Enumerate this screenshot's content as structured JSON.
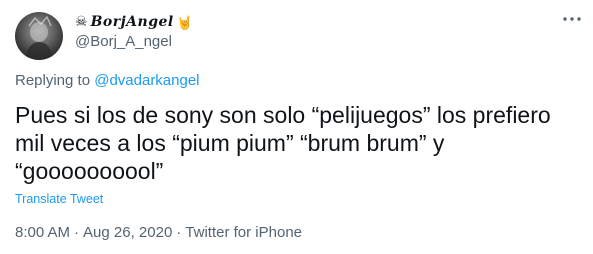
{
  "author": {
    "display_name": "BorjAngel",
    "name_prefix": "☠",
    "name_emoji": "🤘",
    "handle": "@Borj_A_ngel",
    "avatar_icon": "avatar-photo"
  },
  "reply": {
    "prefix": "Replying to",
    "mention": "@dvadarkangel"
  },
  "tweet": {
    "text": "Pues si los de sony son solo “pelijuegos” los prefiero mil veces a los “pium pium” “brum brum” y “goooooooool”",
    "translate_label": "Translate Tweet"
  },
  "meta": {
    "time": "8:00 AM",
    "separator_1": "·",
    "date": "Aug 26, 2020",
    "separator_2": "·",
    "source": "Twitter for iPhone"
  },
  "colors": {
    "text": "#0f1419",
    "secondary": "#536471",
    "link": "#1d9bf0"
  }
}
